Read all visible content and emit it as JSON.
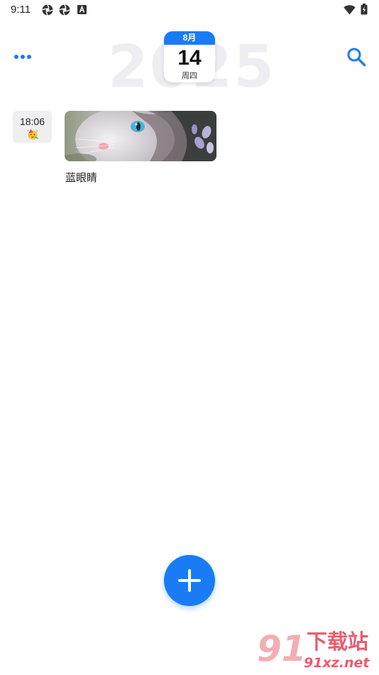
{
  "status_bar": {
    "time": "9:11",
    "left_icons": [
      "aperture-icon",
      "aperture-icon",
      "text-a-icon"
    ],
    "right_icons": [
      "wifi-icon",
      "battery-icon"
    ]
  },
  "header": {
    "year": "2025",
    "calendar": {
      "month": "8月",
      "day": "14",
      "weekday": "周四"
    },
    "accent_color": "#1a7cf5"
  },
  "entries": [
    {
      "time": "18:06",
      "mood_icon": "party-face-emoji",
      "image": "blue-eyed-cat-photo",
      "title": "蓝眼睛"
    }
  ],
  "watermark": {
    "logo_number": "91",
    "name": "下载站",
    "url": "91xz.net"
  }
}
